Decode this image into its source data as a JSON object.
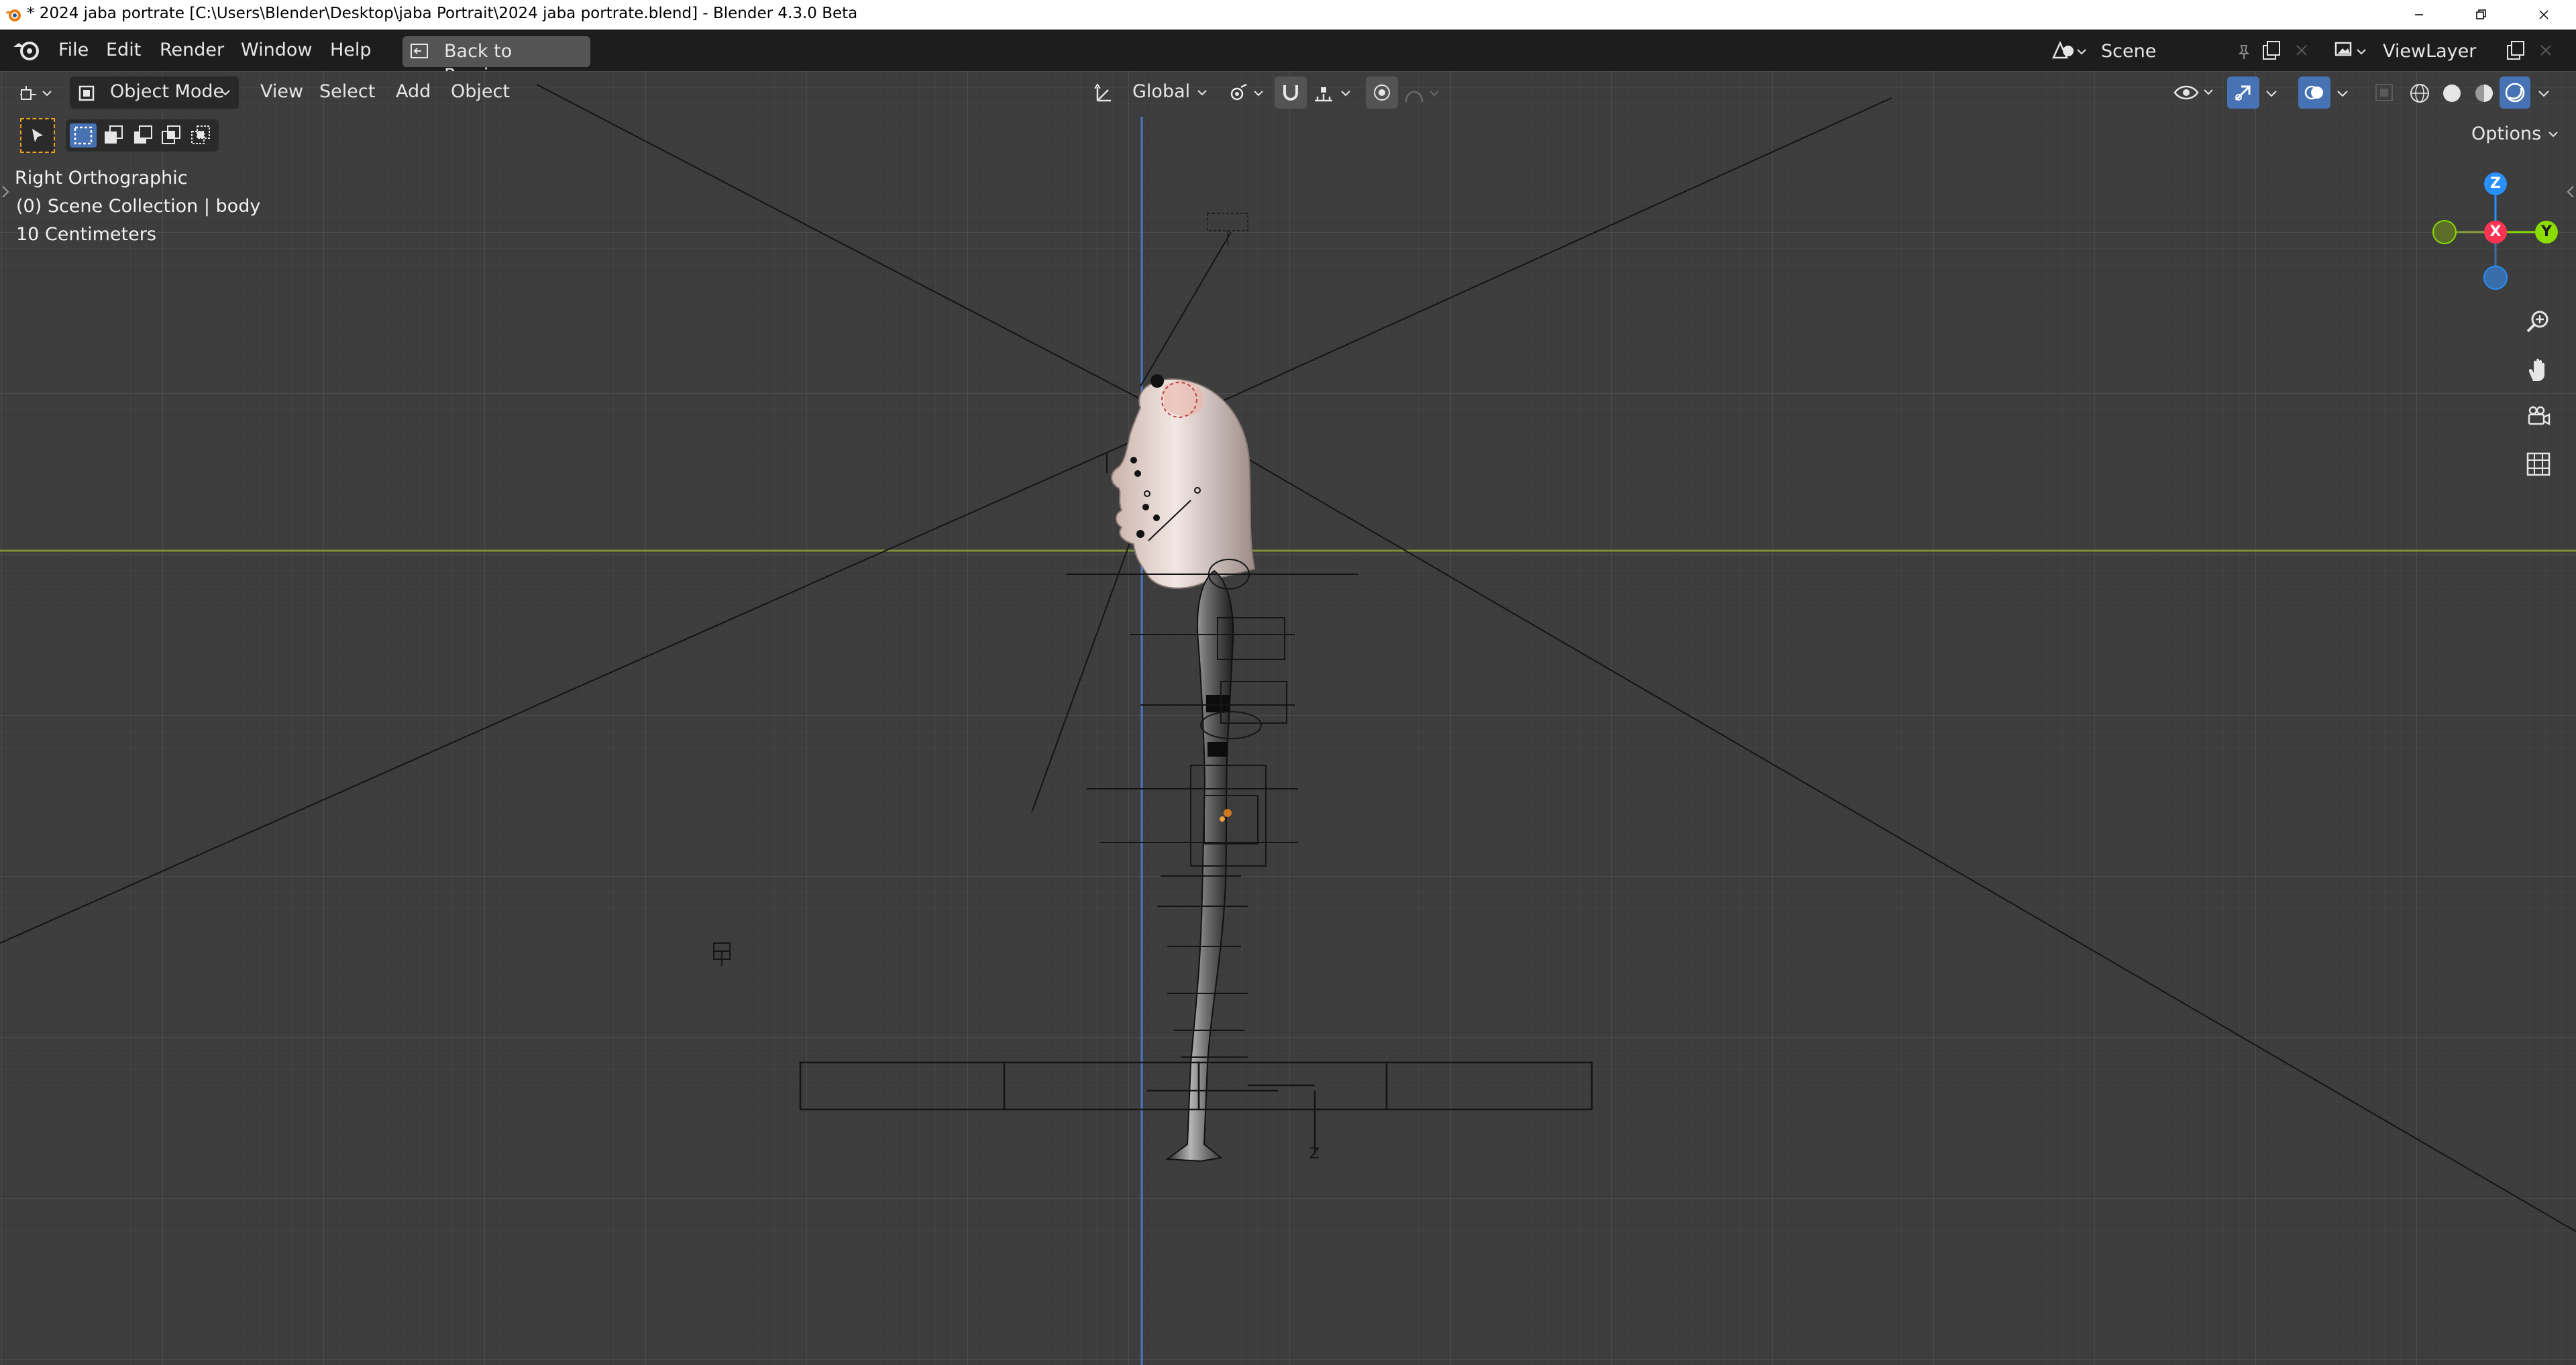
{
  "window": {
    "title": "* 2024 jaba portrate [C:\\Users\\Blender\\Desktop\\jaba Portrait\\2024 jaba portrate.blend] - Blender 4.3.0 Beta"
  },
  "menu": {
    "items": [
      "File",
      "Edit",
      "Render",
      "Window",
      "Help"
    ],
    "back_button": "Back to Previous"
  },
  "scene": {
    "label": "Scene"
  },
  "view_layer": {
    "label": "ViewLayer"
  },
  "viewport_header": {
    "mode": "Object Mode",
    "menus": [
      "View",
      "Select",
      "Add",
      "Object"
    ],
    "transform_orientation": "Global",
    "options_label": "Options"
  },
  "viewport_overlay": {
    "view_name": "Right Orthographic",
    "collection": "(0) Scene Collection | body",
    "scale": "10 Centimeters"
  },
  "gizmo": {
    "z": "Z",
    "x": "X",
    "y": "Y",
    "colors": {
      "x": "#ff3352",
      "y": "#8bdc00",
      "z": "#2890ff",
      "neg_y": "#86a03c",
      "neg_z": "#3a6ea8"
    }
  },
  "navigation_icons": [
    "zoom-icon",
    "pan-hand-icon",
    "camera-view-icon",
    "orthographic-grid-icon"
  ],
  "theme": {
    "viewport_bg": "#3d3d3d",
    "header_bg": "#1d1d1d",
    "z_axis_line": "#4a78c8",
    "y_axis_line": "#7d8f3a"
  },
  "scene_annotations": {
    "empty_label": "Z"
  }
}
